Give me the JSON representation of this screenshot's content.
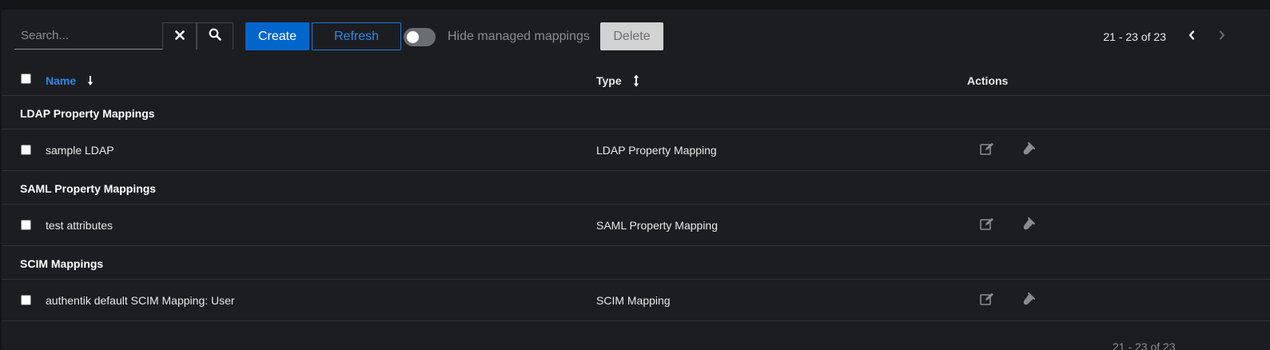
{
  "toolbar": {
    "search_placeholder": "Search...",
    "search_value": "",
    "clear_icon": "close-icon",
    "search_icon": "search-icon",
    "create_label": "Create",
    "refresh_label": "Refresh",
    "toggle_label": "Hide managed mappings",
    "toggle_on": false,
    "delete_label": "Delete"
  },
  "pagination": {
    "range_text": "21 - 23 of 23",
    "prev_icon": "chevron-left-icon",
    "next_icon": "chevron-right-icon"
  },
  "table": {
    "columns": {
      "name": "Name",
      "type": "Type",
      "actions": "Actions"
    },
    "groups": [
      {
        "title": "LDAP Property Mappings",
        "rows": [
          {
            "name": "sample LDAP",
            "type": "LDAP Property Mapping"
          }
        ]
      },
      {
        "title": "SAML Property Mappings",
        "rows": [
          {
            "name": "test attributes",
            "type": "SAML Property Mapping"
          }
        ]
      },
      {
        "title": "SCIM Mappings",
        "rows": [
          {
            "name": "authentik default SCIM Mapping: User",
            "type": "SCIM Mapping"
          }
        ]
      }
    ]
  },
  "bottom_pagination": {
    "range_text": "21 - 23 of 23"
  },
  "colors": {
    "background": "#1c1d21",
    "primary": "#0066cc",
    "link": "#2b8ae8",
    "muted": "#8a8d90"
  }
}
